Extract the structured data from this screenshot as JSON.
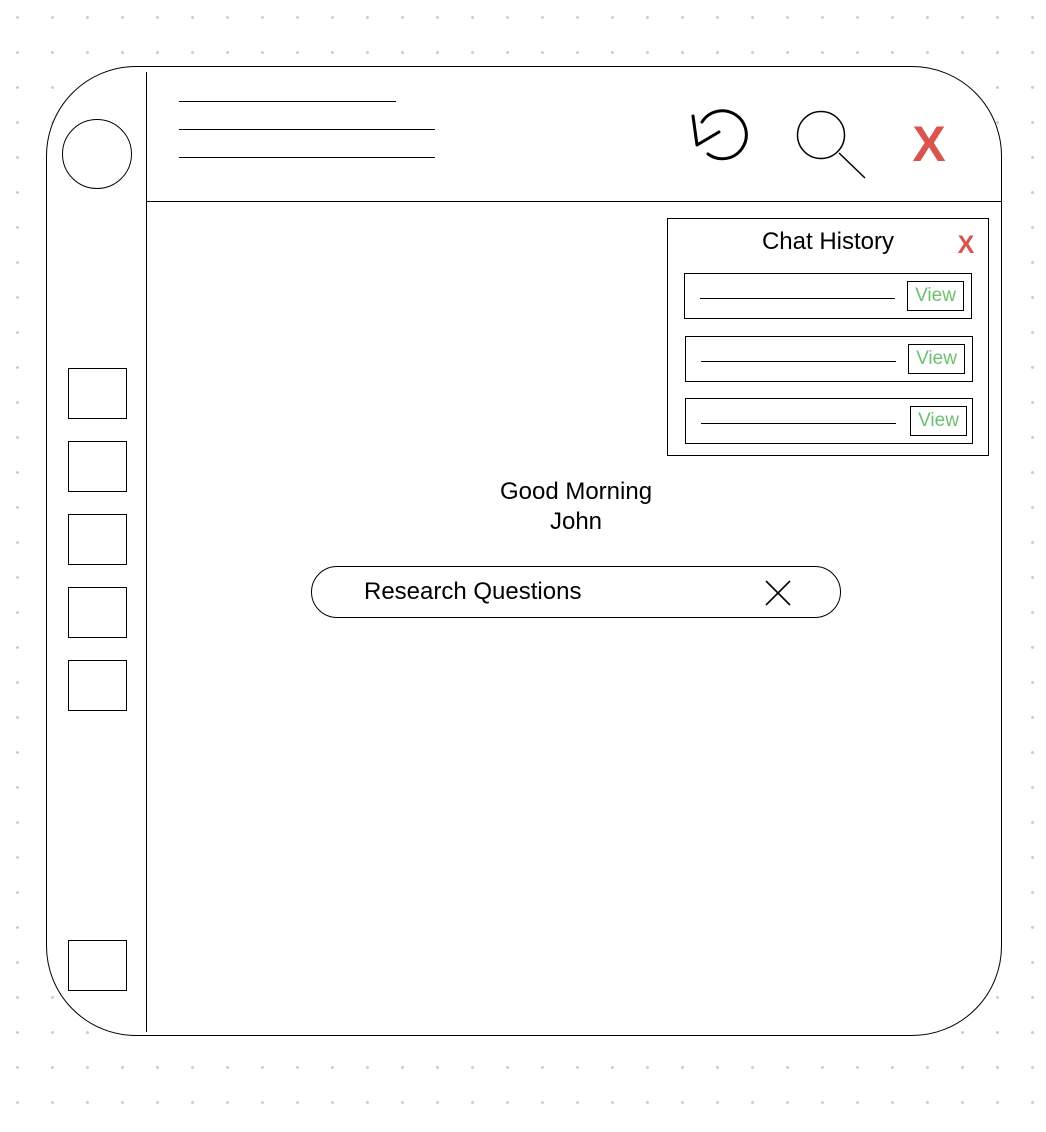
{
  "header": {
    "close_symbol": "X",
    "refresh_icon": "refresh-icon",
    "search_icon": "search-icon",
    "close_color": "#d9534f"
  },
  "chat_history": {
    "title": "Chat History",
    "close_symbol": "X",
    "items": [
      {
        "view_label": "View"
      },
      {
        "view_label": "View"
      },
      {
        "view_label": "View"
      }
    ],
    "view_color": "#6cc070"
  },
  "main": {
    "greeting_line1": "Good Morning",
    "greeting_line2": "John"
  },
  "search": {
    "value": "Research Questions",
    "clear_icon": "clear-icon"
  },
  "sidebar": {
    "nav_count_top": 5,
    "nav_count_bottom": 1
  }
}
